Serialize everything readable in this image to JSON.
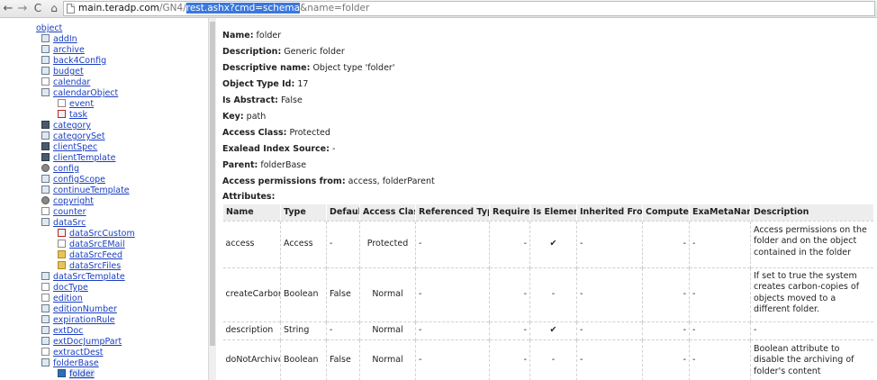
{
  "browser": {
    "url_host": "main.teradp.com",
    "url_path": "/GN4/",
    "url_selected": "rest.ashx?cmd=schema",
    "url_rest": "&name=folder",
    "back_glyph": "←",
    "forward_glyph": "→",
    "reload_glyph": "C",
    "home_glyph": "⌂"
  },
  "tree": {
    "root": "object",
    "items": [
      {
        "label": "addIn",
        "icon": "plugin-icon"
      },
      {
        "label": "archive",
        "icon": "archive-icon"
      },
      {
        "label": "back4Config",
        "icon": "config-icon"
      },
      {
        "label": "budget",
        "icon": "list-icon"
      },
      {
        "label": "calendar",
        "icon": "page-icon"
      },
      {
        "label": "calendarObject",
        "icon": "calendar-icon"
      },
      {
        "label": "event",
        "icon": "event-icon",
        "indent": 2
      },
      {
        "label": "task",
        "icon": "task-icon",
        "indent": 2
      },
      {
        "label": "category",
        "icon": "category-icon"
      },
      {
        "label": "categorySet",
        "icon": "category-set-icon"
      },
      {
        "label": "clientSpec",
        "icon": "monitor-icon"
      },
      {
        "label": "clientTemplate",
        "icon": "monitor-icon"
      },
      {
        "label": "config",
        "icon": "gear-icon"
      },
      {
        "label": "configScope",
        "icon": "config-icon"
      },
      {
        "label": "continueTemplate",
        "icon": "template-icon"
      },
      {
        "label": "copyright",
        "icon": "copyright-icon"
      },
      {
        "label": "counter",
        "icon": "page-icon"
      },
      {
        "label": "dataSrc",
        "icon": "datasource-icon"
      },
      {
        "label": "dataSrcCustom",
        "icon": "custom-icon",
        "indent": 2
      },
      {
        "label": "dataSrcEMail",
        "icon": "email-icon",
        "indent": 2
      },
      {
        "label": "dataSrcFeed",
        "icon": "feed-icon",
        "indent": 2
      },
      {
        "label": "dataSrcFiles",
        "icon": "folder-icon",
        "indent": 2
      },
      {
        "label": "dataSrcTemplate",
        "icon": "template-icon"
      },
      {
        "label": "docType",
        "icon": "page-icon"
      },
      {
        "label": "edition",
        "icon": "page-icon"
      },
      {
        "label": "editionNumber",
        "icon": "list-icon"
      },
      {
        "label": "expirationRule",
        "icon": "rule-icon"
      },
      {
        "label": "extDoc",
        "icon": "extdoc-icon"
      },
      {
        "label": "extDocJumpPart",
        "icon": "extdoc-icon"
      },
      {
        "label": "extractDest",
        "icon": "extract-icon"
      },
      {
        "label": "folderBase",
        "icon": "folder-base-icon"
      },
      {
        "label": "folder",
        "icon": "folder-icon",
        "indent": 2,
        "selected": true
      }
    ]
  },
  "schema": {
    "name_label": "Name:",
    "name": "folder",
    "description_label": "Description:",
    "description": "Generic folder",
    "descriptive_name_label": "Descriptive name:",
    "descriptive_name": "Object type 'folder'",
    "object_type_id_label": "Object Type Id:",
    "object_type_id": "17",
    "is_abstract_label": "Is Abstract:",
    "is_abstract": "False",
    "key_label": "Key:",
    "key": "path",
    "access_class_label": "Access Class:",
    "access_class": "Protected",
    "exalead_label": "Exalead Index Source:",
    "exalead": "-",
    "parent_label": "Parent:",
    "parent": "folderBase",
    "access_permissions_label": "Access permissions from:",
    "access_permissions": "access, folderParent",
    "attributes_label": "Attributes:"
  },
  "attributes": {
    "columns": [
      "Name",
      "Type",
      "Default",
      "Access Class",
      "Referenced Type",
      "Required",
      "Is Element",
      "Inherited From",
      "Computed",
      "ExaMetaName",
      "Description"
    ],
    "rows": [
      {
        "name": "access",
        "type": "Access",
        "default": "-",
        "access_class": "Protected",
        "referenced_type": "-",
        "required": "-",
        "is_element": "✔",
        "inherited_from": "-",
        "computed": "-",
        "exametaname": "-",
        "description": "Access permissions on the folder and on the object contained in the folder"
      },
      {
        "name": "createCarbon",
        "type": "Boolean",
        "default": "False",
        "access_class": "Normal",
        "referenced_type": "-",
        "required": "-",
        "is_element": "-",
        "inherited_from": "-",
        "computed": "-",
        "exametaname": "-",
        "description": "If set to true the system creates carbon-copies of objects moved to a different folder."
      },
      {
        "name": "description",
        "type": "String",
        "default": "-",
        "access_class": "Normal",
        "referenced_type": "-",
        "required": "-",
        "is_element": "✔",
        "inherited_from": "-",
        "computed": "-",
        "exametaname": "-",
        "description": "-"
      },
      {
        "name": "doNotArchive",
        "type": "Boolean",
        "default": "False",
        "access_class": "Normal",
        "referenced_type": "-",
        "required": "-",
        "is_element": "-",
        "inherited_from": "-",
        "computed": "-",
        "exametaname": "-",
        "description": "Boolean attribute to disable the archiving of folder's content"
      }
    ]
  }
}
